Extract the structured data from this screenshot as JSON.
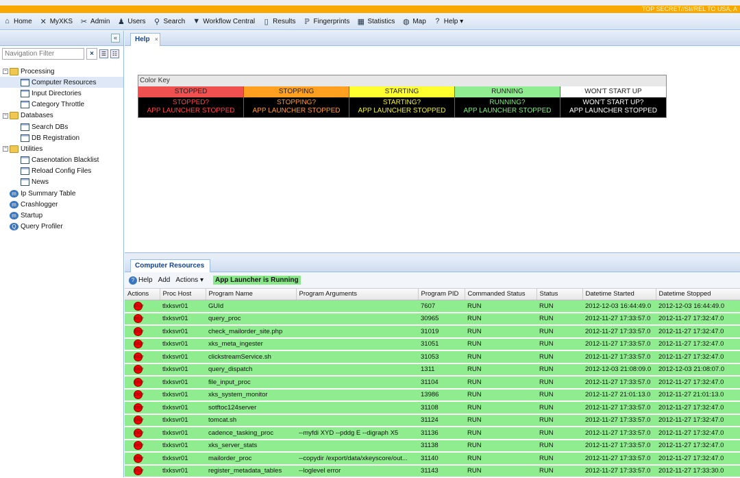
{
  "classification": "TOP SECRET//SI//REL TO USA, A",
  "toolbar": [
    {
      "label": "Home",
      "icon": "home-icon",
      "glyph": "⌂"
    },
    {
      "label": "MyXKS",
      "icon": "x-icon",
      "glyph": "✕"
    },
    {
      "label": "Admin",
      "icon": "tools-icon",
      "glyph": "✂"
    },
    {
      "label": "Users",
      "icon": "user-icon",
      "glyph": "♟"
    },
    {
      "label": "Search",
      "icon": "search-icon",
      "glyph": "⚲"
    },
    {
      "label": "Workflow Central",
      "icon": "workflow-icon",
      "glyph": "▼"
    },
    {
      "label": "Results",
      "icon": "results-icon",
      "glyph": "▯"
    },
    {
      "label": "Fingerprints",
      "icon": "fingerprint-icon",
      "glyph": "ℙ"
    },
    {
      "label": "Statistics",
      "icon": "calculator-icon",
      "glyph": "▦"
    },
    {
      "label": "Map",
      "icon": "globe-icon",
      "glyph": "◍"
    },
    {
      "label": "Help ▾",
      "icon": "help-icon",
      "glyph": "?"
    }
  ],
  "sidebar": {
    "filter_placeholder": "Navigation Filter",
    "tree": [
      {
        "label": "Processing",
        "type": "folder",
        "level": 0
      },
      {
        "label": "Computer Resources",
        "type": "leaf",
        "level": 1,
        "selected": true
      },
      {
        "label": "Input Directories",
        "type": "leaf",
        "level": 1
      },
      {
        "label": "Category Throttle",
        "type": "leaf",
        "level": 1
      },
      {
        "label": "Databases",
        "type": "folder",
        "level": 0
      },
      {
        "label": "Search DBs",
        "type": "leaf",
        "level": 1
      },
      {
        "label": "DB Registration",
        "type": "leaf",
        "level": 1
      },
      {
        "label": "Utilities",
        "type": "folder",
        "level": 0
      },
      {
        "label": "Casenotation Blacklist",
        "type": "leaf",
        "level": 1
      },
      {
        "label": "Reload Config Files",
        "type": "leaf",
        "level": 1
      },
      {
        "label": "News",
        "type": "leaf",
        "level": 1
      },
      {
        "label": "Ip Summary Table",
        "type": "module",
        "level": 0
      },
      {
        "label": "Crashlogger",
        "type": "module",
        "level": 0
      },
      {
        "label": "Startup",
        "type": "module",
        "level": 0
      },
      {
        "label": "Query Profiler",
        "type": "query",
        "level": 0
      }
    ]
  },
  "help_tab": "Help",
  "color_key": {
    "title": "Color Key",
    "items": [
      {
        "label": "STOPPED",
        "bg": "#f05050",
        "q": "STOPPED?",
        "sub": "APP LAUNCHER STOPPED",
        "fg": "#ff4040"
      },
      {
        "label": "STOPPING",
        "bg": "#ffa020",
        "q": "STOPPING?",
        "sub": "APP LAUNCHER STOPPED",
        "fg": "#ff9a20"
      },
      {
        "label": "STARTING",
        "bg": "#ffff30",
        "q": "STARTING?",
        "sub": "APP LAUNCHER STOPPED",
        "fg": "#f0f020"
      },
      {
        "label": "RUNNING",
        "bg": "#90ee90",
        "q": "RUNNING?",
        "sub": "APP LAUNCHER STOPPED",
        "fg": "#80e880"
      },
      {
        "label": "WON'T START UP",
        "bg": "#ffffff",
        "q": "WON'T START UP?",
        "sub": "APP LAUNCHER STOPPED",
        "fg": "#ffffff"
      }
    ]
  },
  "resources": {
    "tab": "Computer Resources",
    "help": "Help",
    "add": "Add",
    "actions": "Actions ▾",
    "status": "App Launcher is Running",
    "columns": [
      "Actions",
      "Proc Host",
      "Program Name",
      "Program Arguments",
      "Program PID",
      "Commanded Status",
      "Status",
      "Datetime Started",
      "Datetime Stopped"
    ],
    "rows": [
      [
        "tlxksvr01",
        "GUId",
        "",
        "7607",
        "RUN",
        "RUN",
        "2012-12-03 16:44:49.0",
        "2012-12-03 16:44:49.0"
      ],
      [
        "tlxksvr01",
        "query_proc",
        "",
        "30965",
        "RUN",
        "RUN",
        "2012-11-27 17:33:57.0",
        "2012-11-27 17:32:47.0"
      ],
      [
        "tlxksvr01",
        "check_mailorder_site.php",
        "",
        "31019",
        "RUN",
        "RUN",
        "2012-11-27 17:33:57.0",
        "2012-11-27 17:32:47.0"
      ],
      [
        "tlxksvr01",
        "xks_meta_ingester",
        "",
        "31051",
        "RUN",
        "RUN",
        "2012-11-27 17:33:57.0",
        "2012-11-27 17:32:47.0"
      ],
      [
        "tlxksvr01",
        "clickstreamService.sh",
        "",
        "31053",
        "RUN",
        "RUN",
        "2012-11-27 17:33:57.0",
        "2012-11-27 17:32:47.0"
      ],
      [
        "tlxksvr01",
        "query_dispatch",
        "",
        "1311",
        "RUN",
        "RUN",
        "2012-12-03 21:08:09.0",
        "2012-12-03 21:08:07.0"
      ],
      [
        "tlxksvr01",
        "file_input_proc",
        "",
        "31104",
        "RUN",
        "RUN",
        "2012-11-27 17:33:57.0",
        "2012-11-27 17:32:47.0"
      ],
      [
        "tlxksvr01",
        "xks_system_monitor",
        "",
        "13986",
        "RUN",
        "RUN",
        "2012-11-27 21:01:13.0",
        "2012-11-27 21:01:13.0"
      ],
      [
        "tlxksvr01",
        "sotftoc124server",
        "",
        "31108",
        "RUN",
        "RUN",
        "2012-11-27 17:33:57.0",
        "2012-11-27 17:32:47.0"
      ],
      [
        "tlxksvr01",
        "tomcat.sh",
        "",
        "31124",
        "RUN",
        "RUN",
        "2012-11-27 17:33:57.0",
        "2012-11-27 17:32:47.0"
      ],
      [
        "tlxksvr01",
        "cadence_tasking_proc",
        "--myfdi XYD --pddg E --digraph X5",
        "31136",
        "RUN",
        "RUN",
        "2012-11-27 17:33:57.0",
        "2012-11-27 17:32:47.0"
      ],
      [
        "tlxksvr01",
        "xks_server_stats",
        "",
        "31138",
        "RUN",
        "RUN",
        "2012-11-27 17:33:57.0",
        "2012-11-27 17:32:47.0"
      ],
      [
        "tlxksvr01",
        "mailorder_proc",
        "--copydir /export/data/xkeyscore/out...",
        "31140",
        "RUN",
        "RUN",
        "2012-11-27 17:33:57.0",
        "2012-11-27 17:32:47.0"
      ],
      [
        "tlxksvr01",
        "register_metadata_tables",
        "--loglevel error",
        "31143",
        "RUN",
        "RUN",
        "2012-11-27 17:33:57.0",
        "2012-11-27 17:33:30.0"
      ]
    ]
  }
}
